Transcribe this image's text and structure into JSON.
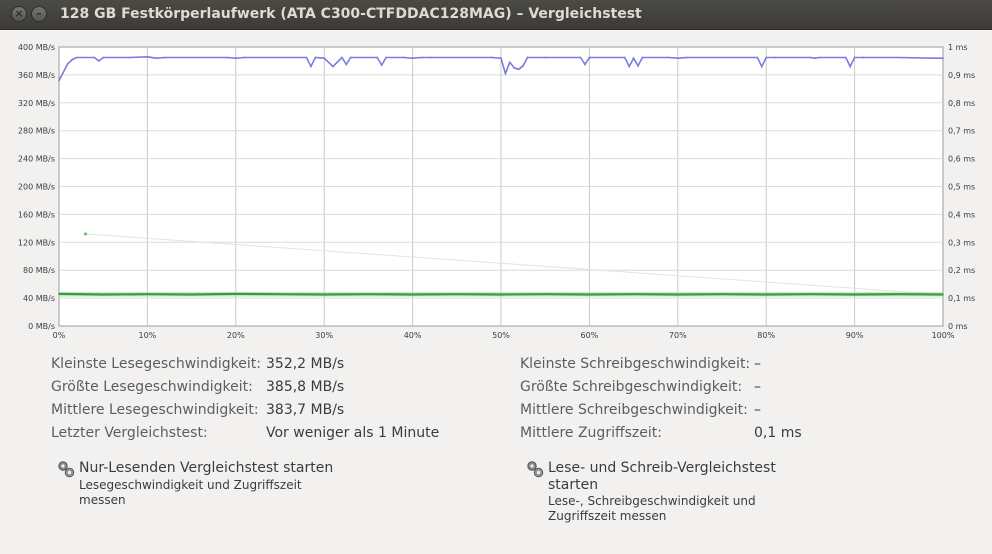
{
  "window": {
    "title": "128 GB Festkörperlaufwerk (ATA C300-CTFDDAC128MAG) – Vergleichstest",
    "close_icon": "close-icon",
    "minimize_icon": "minimize-icon"
  },
  "chart_data": {
    "type": "line",
    "x_label_ticks": [
      "0%",
      "10%",
      "20%",
      "30%",
      "40%",
      "50%",
      "60%",
      "70%",
      "80%",
      "90%",
      "100%"
    ],
    "y_left_ticks": [
      "0 MB/s",
      "40 MB/s",
      "80 MB/s",
      "120 MB/s",
      "160 MB/s",
      "200 MB/s",
      "240 MB/s",
      "280 MB/s",
      "320 MB/s",
      "360 MB/s",
      "400 MB/s"
    ],
    "y_right_ticks": [
      "0 ms",
      "0,1 ms",
      "0,2 ms",
      "0,3 ms",
      "0,4 ms",
      "0,5 ms",
      "0,6 ms",
      "0,7 ms",
      "0,8 ms",
      "0,9 ms",
      "1 ms"
    ],
    "xlim": [
      0,
      100
    ],
    "ylim_left": [
      0,
      400
    ],
    "ylim_right": [
      0,
      1
    ],
    "grid": true,
    "series": [
      {
        "axis": "left",
        "color": "#7b7be0",
        "x": [
          0,
          1,
          1.5,
          2,
          4,
          4.5,
          5,
          8,
          10,
          11,
          12,
          19,
          20,
          21,
          28,
          28.5,
          29,
          30,
          31,
          32,
          32.5,
          33,
          36,
          36.5,
          37,
          39,
          40,
          41,
          42,
          49,
          50,
          50.5,
          51,
          51.5,
          52,
          52.5,
          53,
          55,
          59,
          59.5,
          60,
          64,
          64.5,
          65,
          65.5,
          66,
          69,
          70,
          71,
          79,
          79.5,
          80,
          81,
          85,
          85.5,
          86,
          89,
          89.5,
          90,
          91,
          95,
          99,
          100
        ],
        "y": [
          352,
          376,
          382,
          385,
          385,
          380,
          385,
          385,
          386,
          384,
          385,
          385,
          384,
          385,
          385,
          372,
          385,
          384,
          372,
          385,
          375,
          385,
          385,
          374,
          385,
          385,
          384,
          385,
          385,
          385,
          384,
          362,
          378,
          370,
          368,
          373,
          385,
          385,
          385,
          375,
          385,
          385,
          372,
          384,
          373,
          385,
          385,
          384,
          385,
          385,
          372,
          385,
          385,
          385,
          384,
          385,
          385,
          372,
          385,
          385,
          385,
          384,
          384
        ]
      },
      {
        "axis": "right",
        "color": "#3c9c3c",
        "x": [
          0,
          5,
          10,
          15,
          20,
          25,
          30,
          35,
          40,
          45,
          50,
          55,
          60,
          65,
          70,
          75,
          80,
          85,
          90,
          95,
          100
        ],
        "y": [
          0.115,
          0.113,
          0.114,
          0.113,
          0.115,
          0.114,
          0.113,
          0.114,
          0.113,
          0.114,
          0.113,
          0.114,
          0.113,
          0.114,
          0.113,
          0.114,
          0.113,
          0.114,
          0.113,
          0.114,
          0.113
        ]
      }
    ],
    "outlier": {
      "x": 3,
      "y": 0.33,
      "axis": "right",
      "color": "#55cc55"
    }
  },
  "stats": {
    "min_read_label": "Kleinste Lesegeschwindigkeit:",
    "min_read_value": "352,2 MB/s",
    "max_read_label": "Größte Lesegeschwindigkeit:",
    "max_read_value": "385,8 MB/s",
    "avg_read_label": "Mittlere Lesegeschwindigkeit:",
    "avg_read_value": "383,7 MB/s",
    "last_bench_label": "Letzter Vergleichstest:",
    "last_bench_value": "Vor weniger als 1 Minute",
    "min_write_label": "Kleinste Schreibgeschwindigkeit:",
    "min_write_value": "–",
    "max_write_label": "Größte Schreibgeschwindigkeit:",
    "max_write_value": "–",
    "avg_write_label": "Mittlere Schreibgeschwindigkeit:",
    "avg_write_value": "–",
    "avg_access_label": "Mittlere Zugriffszeit:",
    "avg_access_value": "0,1 ms"
  },
  "actions": {
    "read_only": {
      "icon": "gears-icon",
      "title": "Nur-Lesenden Vergleichstest starten",
      "desc_line1": "Lesegeschwindigkeit und Zugriffszeit",
      "desc_line2": "messen"
    },
    "read_write": {
      "icon": "gears-icon",
      "title_line1": "Lese- und Schreib-Vergleichstest",
      "title_line2": "starten",
      "desc_line1": "Lese-, Schreibgeschwindigkeit und",
      "desc_line2": "Zugriffszeit messen"
    }
  }
}
